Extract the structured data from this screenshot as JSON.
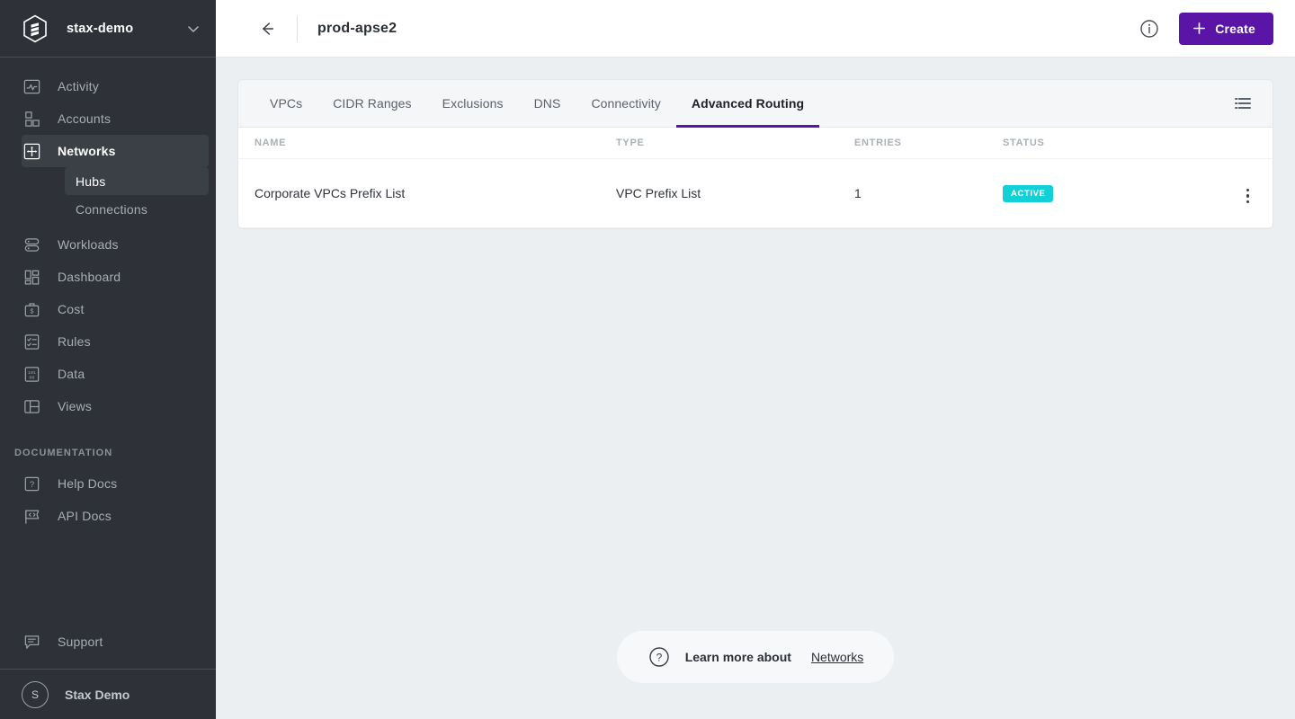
{
  "sidebar": {
    "org": {
      "name": "stax-demo",
      "logo_icon": "stax-hexagon-logo",
      "chevron_icon": "chevron-down-icon"
    },
    "items": [
      {
        "label": "Activity",
        "icon": "activity-pulse-icon",
        "active": false
      },
      {
        "label": "Accounts",
        "icon": "accounts-squares-icon",
        "active": false
      },
      {
        "label": "Networks",
        "icon": "networks-move-icon",
        "active": true
      },
      {
        "label": "Workloads",
        "icon": "workloads-stack-icon",
        "active": false
      },
      {
        "label": "Dashboard",
        "icon": "dashboard-grid-icon",
        "active": false
      },
      {
        "label": "Cost",
        "icon": "cost-briefcase-dollar-icon",
        "active": false
      },
      {
        "label": "Rules",
        "icon": "rules-checklist-icon",
        "active": false
      },
      {
        "label": "Data",
        "icon": "data-binary-icon",
        "active": false
      },
      {
        "label": "Views",
        "icon": "views-panel-icon",
        "active": false
      }
    ],
    "subitems": [
      {
        "label": "Hubs",
        "active": true
      },
      {
        "label": "Connections",
        "active": false
      }
    ],
    "documentation_label": "DOCUMENTATION",
    "doc_items": [
      {
        "label": "Help Docs",
        "icon": "help-question-icon"
      },
      {
        "label": "API Docs",
        "icon": "api-code-flag-icon"
      }
    ],
    "support": {
      "label": "Support",
      "icon": "support-chat-icon"
    },
    "user": {
      "name": "Stax Demo",
      "initial": "S",
      "avatar_icon": "user-avatar"
    }
  },
  "topbar": {
    "back_icon": "arrow-left-icon",
    "title": "prod-apse2",
    "info_icon": "info-circle-icon",
    "create_label": "Create",
    "create_icon": "plus-icon",
    "accent_color": "#5a14a6"
  },
  "card": {
    "tabs": [
      {
        "label": "VPCs",
        "active": false
      },
      {
        "label": "CIDR Ranges",
        "active": false
      },
      {
        "label": "Exclusions",
        "active": false
      },
      {
        "label": "DNS",
        "active": false
      },
      {
        "label": "Connectivity",
        "active": false
      },
      {
        "label": "Advanced Routing",
        "active": true
      }
    ],
    "list_view_icon": "list-view-icon",
    "table": {
      "columns": [
        "NAME",
        "TYPE",
        "ENTRIES",
        "STATUS",
        ""
      ],
      "rows": [
        {
          "name": "Corporate VPCs Prefix List",
          "type": "VPC Prefix List",
          "entries": "1",
          "status": "ACTIVE",
          "status_color": "#11d0d6",
          "menu_icon": "kebab-menu-icon"
        }
      ]
    }
  },
  "footer": {
    "help_icon": "help-question-circle-icon",
    "text": "Learn more about",
    "link": "Networks"
  }
}
